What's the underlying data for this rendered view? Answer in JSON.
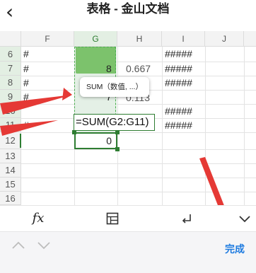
{
  "header": {
    "back_icon": "chevron-left-icon",
    "title": "表格 - 金山文档"
  },
  "columns": [
    "F",
    "G",
    "H",
    "I",
    "J"
  ],
  "rows": [
    "6",
    "7",
    "8",
    "9",
    "10",
    "11",
    "12",
    "13",
    "14",
    "15",
    "16"
  ],
  "cells": {
    "E6": "#",
    "E7": "#",
    "E8": "#",
    "E9": "#",
    "E11": "#",
    "I6": "#####",
    "I7": "#####",
    "I8": "#####",
    "I10": "#####",
    "I11": "#####",
    "H7": "0.667",
    "H9": "0.113",
    "G7": "8",
    "G8": "8",
    "G9": "7",
    "G12": "0"
  },
  "formula_bar": {
    "tooltip": "SUM（数值, ...）",
    "formula": "=SUM(G2:G11)"
  },
  "toolbar": {
    "fx": "fx",
    "table_icon": "table-icon",
    "enter_icon": "enter-icon",
    "collapse_icon": "chevron-down-icon"
  },
  "bottom_bar": {
    "done_label": "完成"
  },
  "colors": {
    "accent_green": "#2e7d32",
    "selection_fill": "#e4f0e6",
    "done_blue": "#1e7be0",
    "arrow_red": "#e53935"
  }
}
